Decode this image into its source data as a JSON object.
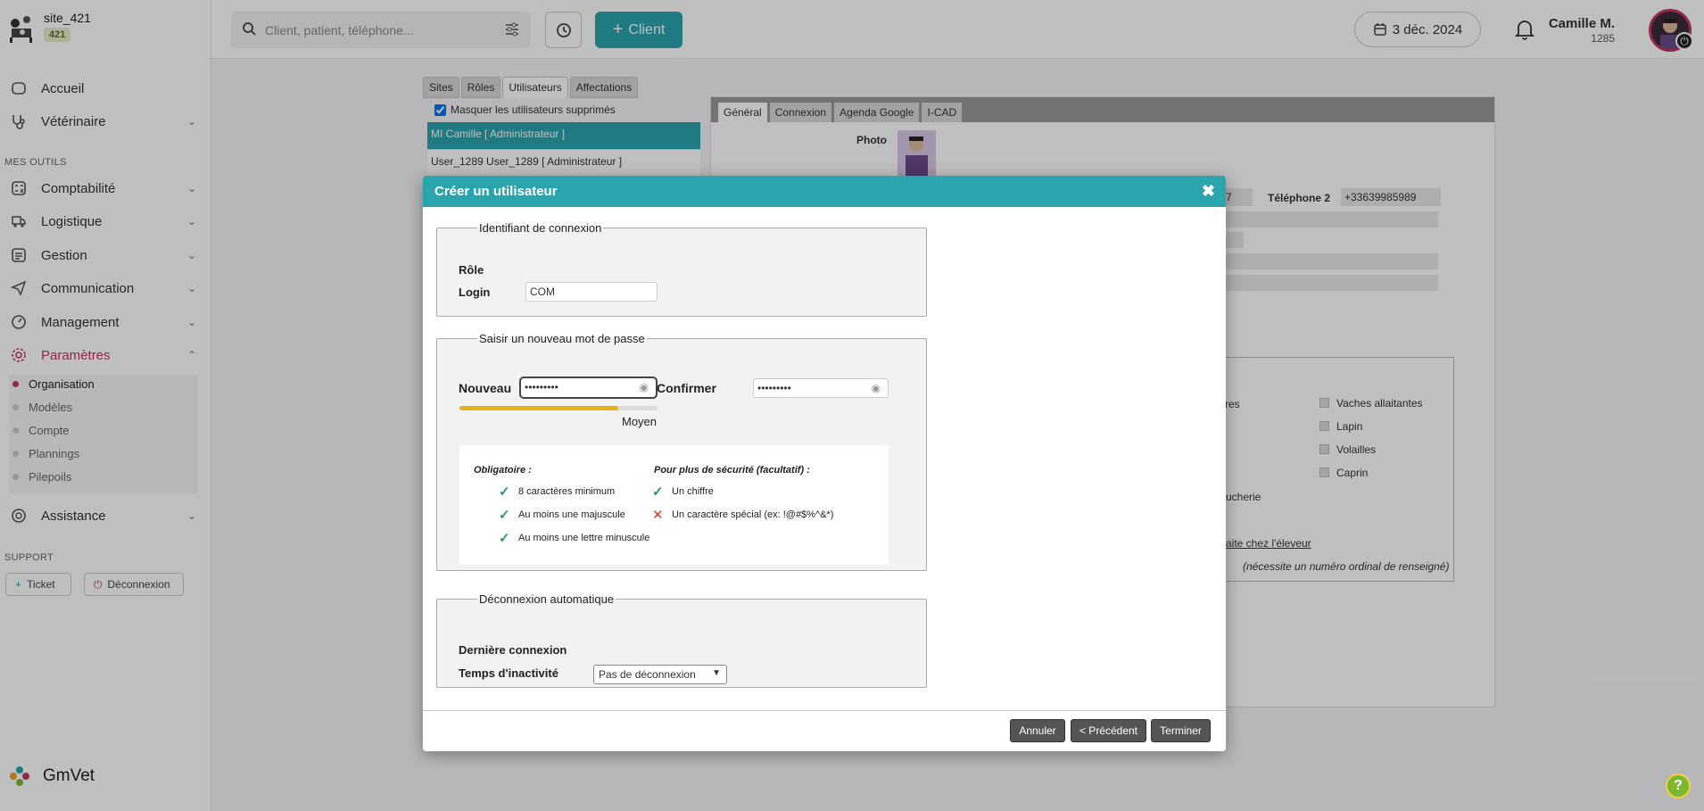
{
  "brand": {
    "site": "site_421",
    "badge": "421",
    "app_name": "GmVet"
  },
  "sidebar": {
    "items": [
      {
        "label": "Accueil",
        "icon": "home-icon"
      },
      {
        "label": "Vétérinaire",
        "icon": "stethoscope-icon"
      },
      {
        "label": "Comptabilité",
        "icon": "calculator-icon"
      },
      {
        "label": "Logistique",
        "icon": "truck-icon"
      },
      {
        "label": "Gestion",
        "icon": "folder-icon"
      },
      {
        "label": "Communication",
        "icon": "send-icon"
      },
      {
        "label": "Management",
        "icon": "gauge-icon"
      },
      {
        "label": "Paramètres",
        "icon": "gear-icon"
      },
      {
        "label": "Assistance",
        "icon": "help-circle-icon"
      }
    ],
    "section_tools": "MES OUTILS",
    "section_support": "SUPPORT",
    "subitems": [
      "Organisation",
      "Modèles",
      "Compte",
      "Plannings",
      "Pilepoils"
    ],
    "ticket_label": "Ticket",
    "logout_label": "Déconnexion"
  },
  "header": {
    "search_placeholder": "Client, patient, téléphone...",
    "client_button": "Client",
    "date": "3 déc. 2024",
    "user_name": "Camille M.",
    "user_id": "1285"
  },
  "background": {
    "tabs": [
      "Sites",
      "Rôles",
      "Utilisateurs",
      "Affectations"
    ],
    "mask_label": "Masquer les utilisateurs supprimés",
    "users": [
      "MI Camille [ Administrateur ]",
      "User_1289 User_1289 [ Administrateur ]"
    ],
    "right_tabs": [
      "Général",
      "Connexion",
      "Agenda Google",
      "I-CAD"
    ],
    "photo_label": "Photo",
    "tel2_label": "Téléphone 2",
    "tel2_value": "+33639985989",
    "tel_fragment": "7",
    "species": [
      "Vaches allaitantes",
      "Lapin",
      "Volailles",
      "Caprin"
    ],
    "frag_res": "res",
    "frag_boucherie": "ucherie",
    "link_eleveur": "aite chez l'éleveur",
    "note_ordinal": "(nécessite un numéro ordinal de renseigné)"
  },
  "dialog": {
    "title": "Créer un utilisateur",
    "login_section": "Identifiant de connexion",
    "role_label": "Rôle",
    "login_label": "Login",
    "login_value": "COM",
    "password_section": "Saisir un nouveau mot de passe",
    "new_label": "Nouveau",
    "new_value": "•••••••••",
    "confirm_label": "Confirmer",
    "confirm_value": "•••••••••",
    "strength_label": "Moyen",
    "strength_fraction": 0.8,
    "mandatory_head": "Obligatoire :",
    "optional_head": "Pour plus de sécurité (facultatif) :",
    "rules_mandatory": [
      "8 caractères minimum",
      "Au moins une majuscule",
      "Au moins une lettre minuscule"
    ],
    "rules_optional": [
      "Un chiffre",
      "Un caractère spécial (ex: !@#$%^&*)"
    ],
    "auto_logout_section": "Déconnexion automatique",
    "last_login_label": "Dernière connexion",
    "inactivity_label": "Temps d'inactivité",
    "inactivity_value": "Pas de déconnexion",
    "cancel": "Annuler",
    "previous": "< Précédent",
    "finish": "Terminer"
  },
  "colors": {
    "accent": "#2aa4ad",
    "active": "#c0365f",
    "strength": "#e5b215",
    "check_ok": "#2a9a5a",
    "check_ko": "#dd3333"
  }
}
